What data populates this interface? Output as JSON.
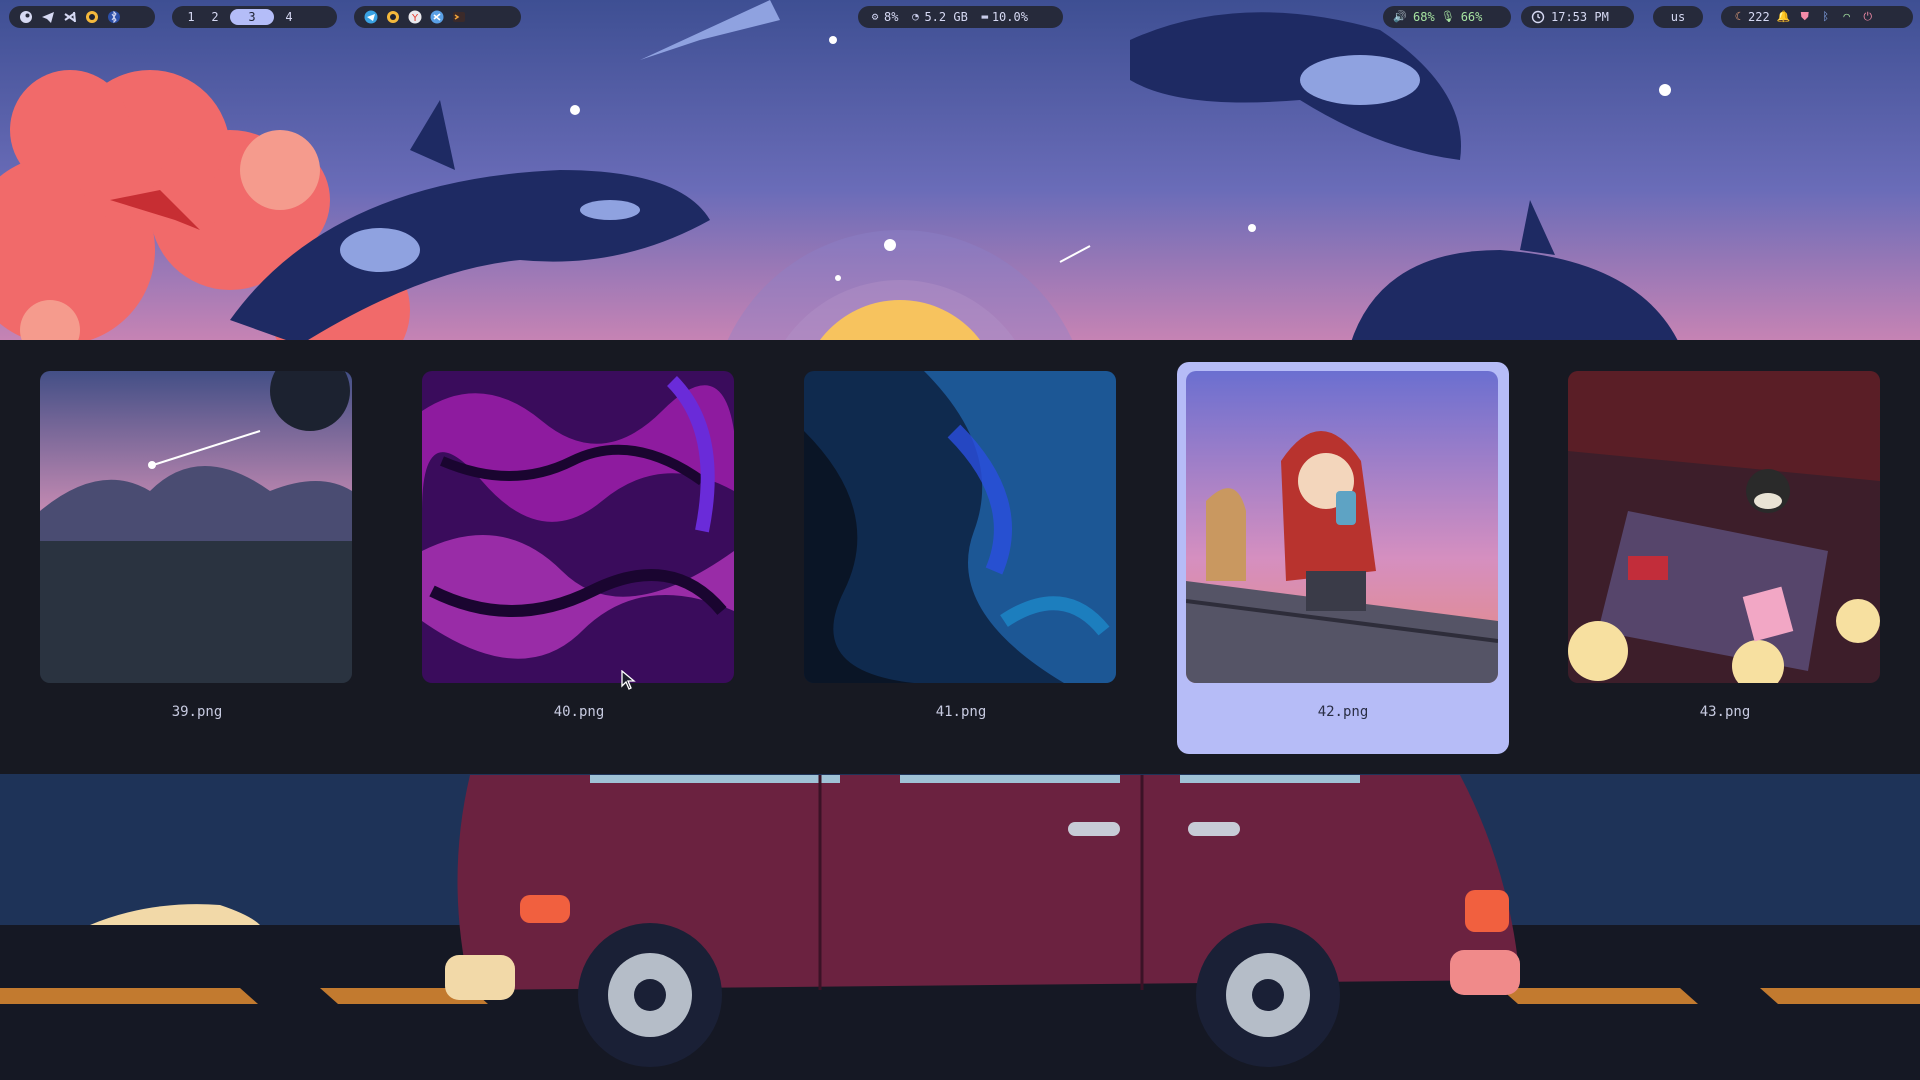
{
  "topbar": {
    "left_apps": [
      "steam-icon",
      "telegram-icon",
      "vscode-icon",
      "weather-app-icon",
      "bluetooth-icon"
    ],
    "workspaces": [
      {
        "label": "1",
        "active": false
      },
      {
        "label": "2",
        "active": false
      },
      {
        "label": "3",
        "active": true
      },
      {
        "label": "4",
        "active": false
      }
    ],
    "running_apps": [
      "telegram-icon",
      "sun-app-icon",
      "yandex-icon",
      "vscode-icon",
      "terminal-icon"
    ],
    "system": {
      "cpu": "8%",
      "memory": "5.2 GB",
      "disk": "10.0%"
    },
    "audio": {
      "volume": "68%",
      "mic": "66%"
    },
    "clock": "17:53 PM",
    "keyboard_layout": "us",
    "tray": {
      "count": "222"
    }
  },
  "wallpaper_selector": {
    "selected_index": 3,
    "items": [
      {
        "file": "39.png"
      },
      {
        "file": "40.png"
      },
      {
        "file": "41.png"
      },
      {
        "file": "42.png"
      },
      {
        "file": "43.png"
      }
    ]
  },
  "colors": {
    "accent": "#b4bdf8",
    "bar_bg": "#262a3b",
    "panel_bg": "#171922"
  }
}
